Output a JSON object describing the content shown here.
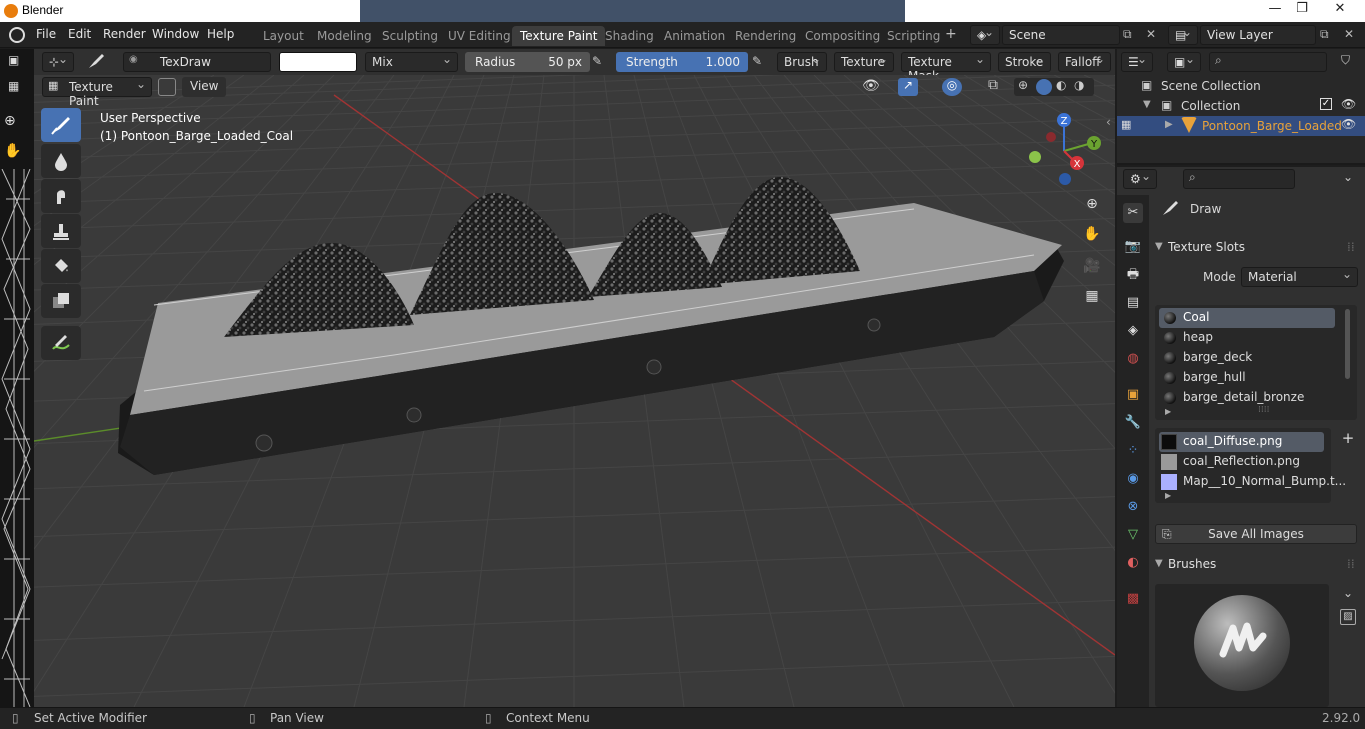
{
  "window": {
    "title": "Blender"
  },
  "menu": [
    "File",
    "Edit",
    "Render",
    "Window",
    "Help"
  ],
  "workspaces": [
    "Layout",
    "Modeling",
    "Sculpting",
    "UV Editing",
    "Texture Paint",
    "Shading",
    "Animation",
    "Rendering",
    "Compositing",
    "Scripting"
  ],
  "active_workspace": "Texture Paint",
  "scene": {
    "label": "Scene",
    "view_layer": "View Layer"
  },
  "tool_header": {
    "brush_name": "TexDraw",
    "blend_mode": "Mix",
    "radius_label": "Radius",
    "radius_value": "50 px",
    "strength_label": "Strength",
    "strength_value": "1.000",
    "strength_fraction": 1.0,
    "menus": [
      "Brush",
      "Texture",
      "Texture Mask",
      "Stroke",
      "Falloff"
    ]
  },
  "viewport_header": {
    "mode": "Texture Paint",
    "view": "View"
  },
  "viewport": {
    "perspective": "User Perspective",
    "object": "(1) Pontoon_Barge_Loaded_Coal",
    "gizmo_axes": [
      "Z",
      "Y",
      "X"
    ]
  },
  "outliner": {
    "scene_collection": "Scene Collection",
    "collection": "Collection",
    "object": "Pontoon_Barge_Loaded"
  },
  "properties": {
    "tool_name": "Draw",
    "texture_slots_title": "Texture Slots",
    "mode_label": "Mode",
    "mode_value": "Material",
    "materials": [
      "Coal",
      "heap",
      "barge_deck",
      "barge_hull",
      "barge_detail_bronze"
    ],
    "selected_material": "Coal",
    "images": [
      "coal_Diffuse.png",
      "coal_Reflection.png",
      "Map__10_Normal_Bump.t..."
    ],
    "selected_image": "coal_Diffuse.png",
    "save_all": "Save All Images",
    "brushes_title": "Brushes"
  },
  "status_bar": {
    "left": "Set Active Modifier",
    "middle": "Pan View",
    "right": "Context Menu",
    "version": "2.92.0"
  },
  "colors": {
    "accent": "#4772b3",
    "selected": "#545b66",
    "object_orange": "#e8a23a"
  }
}
